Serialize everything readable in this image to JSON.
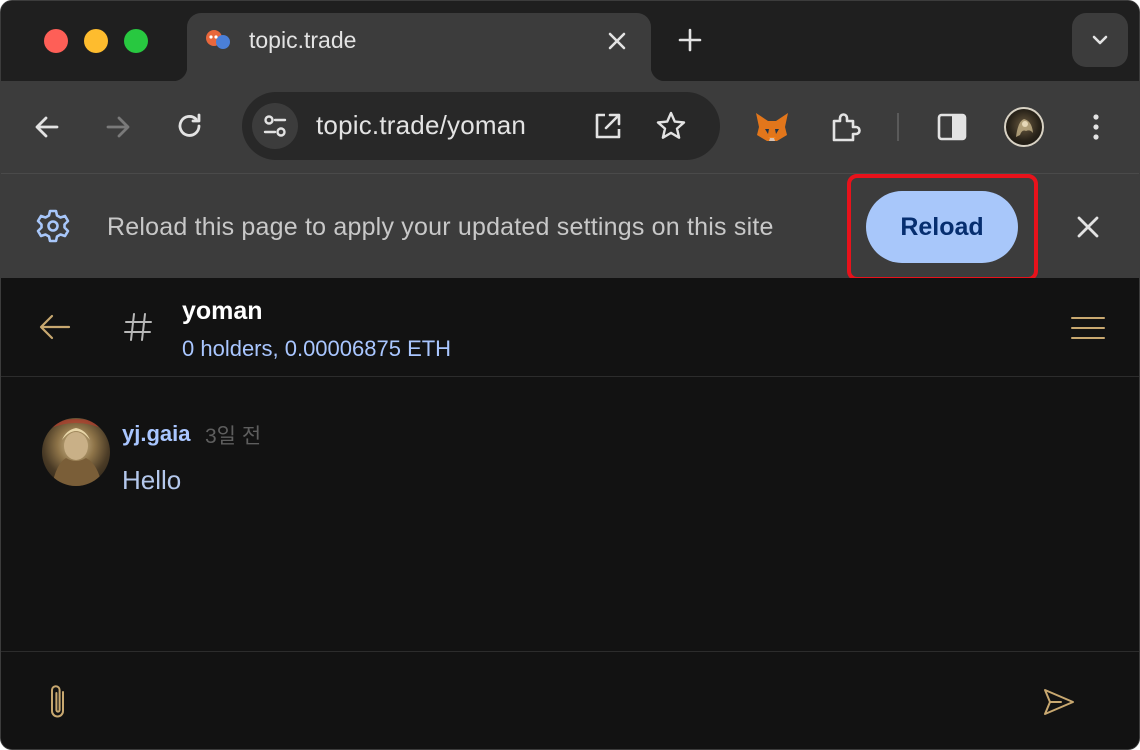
{
  "browser": {
    "tab": {
      "title": "topic.trade",
      "favicon": "topic-trade-favicon"
    },
    "address_bar": {
      "url": "topic.trade/yoman"
    },
    "icons": {
      "back": "arrow-left-icon",
      "forward": "arrow-right-icon",
      "reload": "refresh-icon",
      "site_info": "tune-icon",
      "open_external": "open-in-new-icon",
      "bookmark": "star-icon",
      "metamask": "fox-icon",
      "extensions": "puzzle-icon",
      "side_panel": "side-panel-icon",
      "more": "kebab-menu-icon"
    }
  },
  "infobar": {
    "message": "Reload this page to apply your updated settings on this site",
    "reload_label": "Reload",
    "highlight_color": "#e8121b"
  },
  "channel": {
    "name": "yoman",
    "subtitle": "0 holders, 0.00006875 ETH"
  },
  "messages": [
    {
      "author": "yj.gaia",
      "time": "3일 전",
      "text": "Hello"
    }
  ],
  "colors": {
    "accent_blue": "#a8c7fa",
    "link_blue": "#a9c6ff",
    "gold_icons": "#c8a870"
  }
}
